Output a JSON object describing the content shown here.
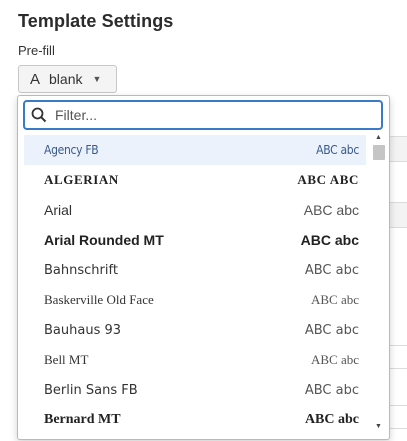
{
  "page": {
    "title": "Template Settings",
    "prefill_label": "Pre-fill",
    "prefill_value": "blank",
    "prefill_glyph": "A"
  },
  "filter": {
    "placeholder": "Filter..."
  },
  "fonts": [
    {
      "name": "Agency FB",
      "sample": "ABC abc",
      "selected": true
    },
    {
      "name": "ALGERIAN",
      "sample": "ABC ABC",
      "selected": false
    },
    {
      "name": "Arial",
      "sample": "ABC abc",
      "selected": false
    },
    {
      "name": "Arial Rounded MT",
      "sample": "ABC abc",
      "selected": false
    },
    {
      "name": "Bahnschrift",
      "sample": "ABC abc",
      "selected": false
    },
    {
      "name": "Baskerville Old Face",
      "sample": "ABC abc",
      "selected": false
    },
    {
      "name": "Bauhaus 93",
      "sample": "ABC abc",
      "selected": false
    },
    {
      "name": "Bell MT",
      "sample": "ABC abc",
      "selected": false
    },
    {
      "name": "Berlin Sans FB",
      "sample": "ABC abc",
      "selected": false
    },
    {
      "name": "Bernard MT",
      "sample": "ABC abc",
      "selected": false
    }
  ],
  "colors": {
    "accent": "#3a7bc8",
    "selected_bg": "#ebf2fb"
  },
  "icons": {
    "filter": "search-icon",
    "prefill": "text-icon",
    "caret": "caret-down-icon"
  }
}
